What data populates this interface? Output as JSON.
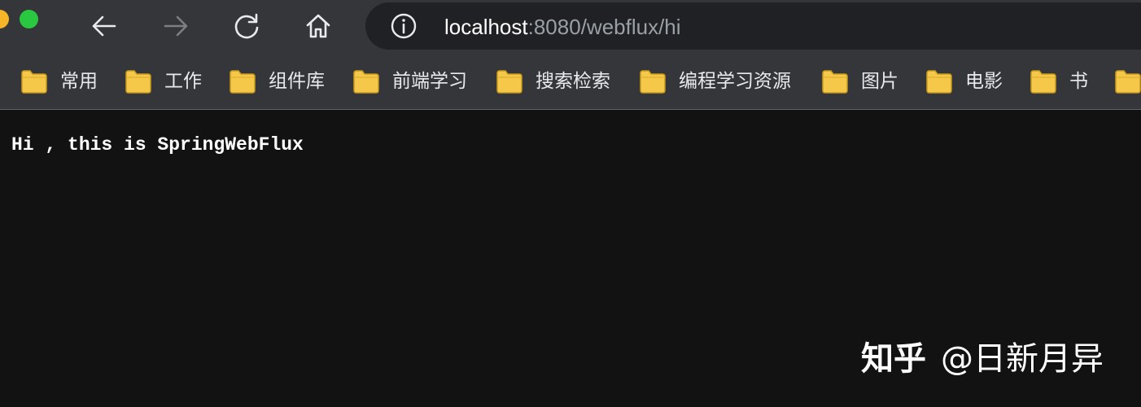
{
  "window": {
    "traffic_lights": [
      "minimize",
      "zoom"
    ]
  },
  "toolbar": {
    "back_icon": "arrow-left-icon",
    "forward_icon": "arrow-right-icon",
    "reload_icon": "reload-icon",
    "home_icon": "home-icon",
    "url_host": "localhost",
    "url_rest": ":8080/webflux/hi"
  },
  "bookmarks": [
    {
      "label": "常用"
    },
    {
      "label": "工作"
    },
    {
      "label": "组件库"
    },
    {
      "label": "前端学习"
    },
    {
      "label": "搜索检索"
    },
    {
      "label": "编程学习资源"
    },
    {
      "label": "图片"
    },
    {
      "label": "电影"
    },
    {
      "label": "书"
    }
  ],
  "page": {
    "body_text": "Hi , this is SpringWebFlux"
  },
  "watermark": {
    "brand": "知乎",
    "author": "@日新月异"
  },
  "colors": {
    "chrome_bg": "#35363a",
    "omnibox_bg": "#202124",
    "page_bg": "#121212",
    "folder_yellow": "#f5c84a"
  }
}
